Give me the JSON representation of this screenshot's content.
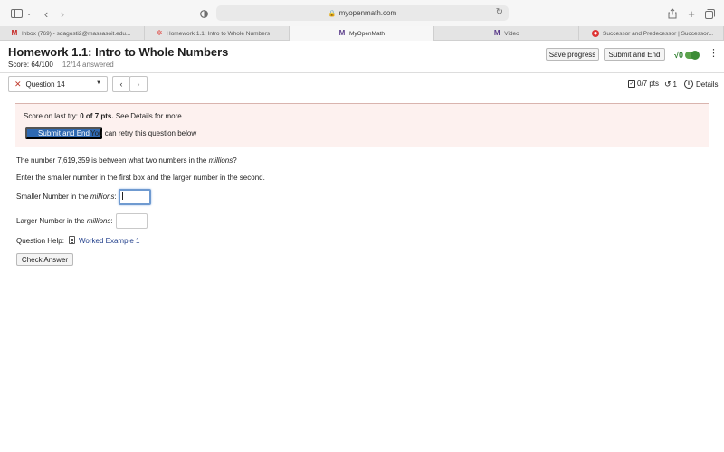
{
  "browser": {
    "url": "myopenmath.com",
    "tabs": [
      {
        "label": "Inbox (769) - sdagosti2@massasoit.edu...",
        "icon": "gmail-icon"
      },
      {
        "label": "Homework 1.1: Intro to Whole Numbers",
        "icon": "myopenmath-star-icon"
      },
      {
        "label": "MyOpenMath",
        "icon": "myopenmath-icon",
        "active": true
      },
      {
        "label": "Video",
        "icon": "myopenmath-icon"
      },
      {
        "label": "Successor and Predecessor | Successor...",
        "icon": "youtube-icon"
      }
    ]
  },
  "header": {
    "title": "Homework 1.1: Intro to Whole Numbers",
    "score": "Score: 64/100",
    "answered": "12/14 answered",
    "save_label": "Save progress",
    "submit_label": "Submit and End",
    "sqrt_symbol": "√0"
  },
  "question_nav": {
    "selected": "Question 14",
    "prev": "‹",
    "next": "›",
    "points": "0/7 pts",
    "attempts": "1",
    "details": "Details"
  },
  "alert": {
    "score_prefix": "Score on last try: ",
    "score_value": "0 of 7 pts.",
    "score_suffix": " See Details for more.",
    "submit_label": "Submit and End",
    "retry_text": "You can retry this question below"
  },
  "question": {
    "line1_pre": "The number 7,619,359 is between what two numbers in the ",
    "line1_em": "millions",
    "line1_post": "?",
    "line2": "Enter the smaller number in the first box and the larger number in the second.",
    "smaller_pre": "Smaller Number in the ",
    "smaller_em": "millions",
    "smaller_post": ":",
    "smaller_value": "",
    "larger_pre": "Larger Number in the ",
    "larger_em": "millions",
    "larger_post": ":",
    "larger_value": "",
    "help_label": "Question Help:",
    "help_link": "Worked Example 1",
    "check_label": "Check Answer"
  },
  "colors": {
    "accent_blue": "#2f69b2",
    "alert_bg": "#fdf1ef",
    "toggle_green": "#5aa34a"
  }
}
